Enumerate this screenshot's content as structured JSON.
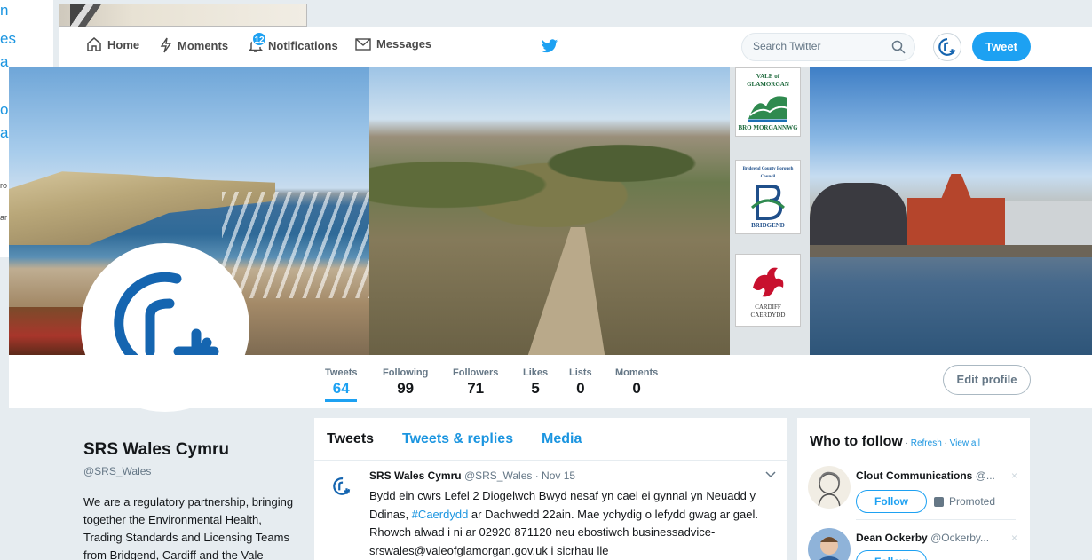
{
  "background_page": {
    "fragments": [
      "n",
      "es",
      "a",
      "o",
      "a"
    ],
    "small_fragments": [
      "ro",
      "ar"
    ]
  },
  "nav": {
    "home": "Home",
    "moments": "Moments",
    "notifications": "Notifications",
    "notifications_count": "12",
    "messages": "Messages",
    "search_placeholder": "Search Twitter",
    "tweet_button": "Tweet"
  },
  "banner": {
    "logos": [
      {
        "name": "vale-of-glamorgan",
        "top_text": "VALE of GLAMORGAN",
        "bottom_text": "BRO MORGANNWG"
      },
      {
        "name": "bridgend",
        "top_text": "Bridgend County Borough Council",
        "bottom_text": "BRIDGEND"
      },
      {
        "name": "cardiff",
        "top_text": "CARDIFF",
        "bottom_text": "CAERDYDD"
      }
    ]
  },
  "profile": {
    "name": "SRS Wales Cymru",
    "handle": "@SRS_Wales",
    "bio_lines": [
      "We are a regulatory partnership, bringing",
      "together the Environmental Health,",
      "Trading Standards and Licensing Teams",
      "from Bridgend, Cardiff and the Vale"
    ]
  },
  "stats": [
    {
      "label": "Tweets",
      "value": "64"
    },
    {
      "label": "Following",
      "value": "99"
    },
    {
      "label": "Followers",
      "value": "71"
    },
    {
      "label": "Likes",
      "value": "5"
    },
    {
      "label": "Lists",
      "value": "0"
    },
    {
      "label": "Moments",
      "value": "0"
    }
  ],
  "edit_profile": "Edit profile",
  "timeline": {
    "tabs": [
      "Tweets",
      "Tweets & replies",
      "Media"
    ],
    "tweet": {
      "name": "SRS Wales Cymru",
      "meta": "@SRS_Wales · Nov 15",
      "text_before": "Bydd ein cwrs Lefel 2 Diogelwch Bwyd nesaf yn cael ei gynnal yn Neuadd y Ddinas, ",
      "hashtag": "#Caerdydd",
      "text_after": " ar Dachwedd 22ain. Mae ychydig o lefydd gwag ar gael. Rhowch alwad i ni ar 02920 871120 neu ebostiwch businessadvice-srswales@valeofglamorgan.gov.uk i sicrhau lle"
    }
  },
  "who_to_follow": {
    "title": "Who to follow",
    "refresh": "Refresh",
    "view_all": "View all",
    "dot": " · ",
    "suggestions": [
      {
        "name": "Clout Communications",
        "handle": "@...",
        "follow": "Follow",
        "promoted": "Promoted"
      },
      {
        "name": "Dean Ockerby",
        "handle": "@Ockerby...",
        "follow": "Follow"
      }
    ],
    "close": "×"
  },
  "colors": {
    "accent": "#1da1f2",
    "link": "#1b95e0",
    "text": "#14171a",
    "muted": "#657786",
    "background": "#e6ecf0"
  }
}
